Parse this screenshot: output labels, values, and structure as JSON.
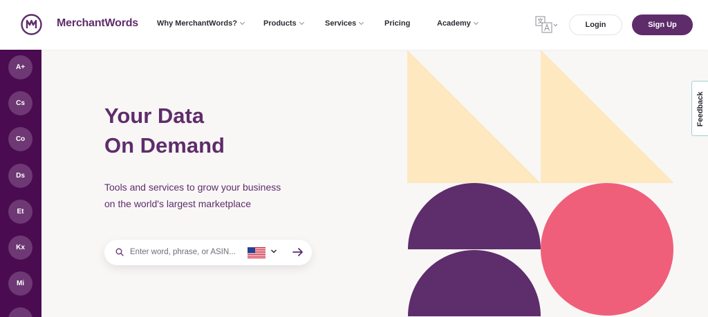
{
  "header": {
    "brand": "MerchantWords",
    "nav": [
      {
        "label": "Why MerchantWords?",
        "has_dropdown": true
      },
      {
        "label": "Products",
        "has_dropdown": true
      },
      {
        "label": "Services",
        "has_dropdown": true
      },
      {
        "label": "Pricing",
        "has_dropdown": false
      },
      {
        "label": "Academy",
        "has_dropdown": true
      }
    ],
    "language_icon": "translate-icon",
    "login_label": "Login",
    "signup_label": "Sign Up"
  },
  "sidebar": {
    "items": [
      {
        "label": "A+"
      },
      {
        "label": "Cs"
      },
      {
        "label": "Co"
      },
      {
        "label": "Ds"
      },
      {
        "label": "Et"
      },
      {
        "label": "Kx"
      },
      {
        "label": "Mi"
      }
    ]
  },
  "hero": {
    "title_line1": "Your Data",
    "title_line2": "On Demand",
    "subtitle_line1": "Tools and services to grow your business",
    "subtitle_line2": "on the world's largest marketplace"
  },
  "search": {
    "placeholder": "Enter word, phrase, or ASIN...",
    "value": "",
    "marketplace_flag": "us-flag-icon"
  },
  "feedback": {
    "label": "Feedback"
  },
  "colors": {
    "brand_purple": "#5f2c6b",
    "sidebar_purple": "#4a0b50",
    "cream": "#fde8c0",
    "pink": "#f05f7a",
    "background": "#f8f7f6"
  }
}
